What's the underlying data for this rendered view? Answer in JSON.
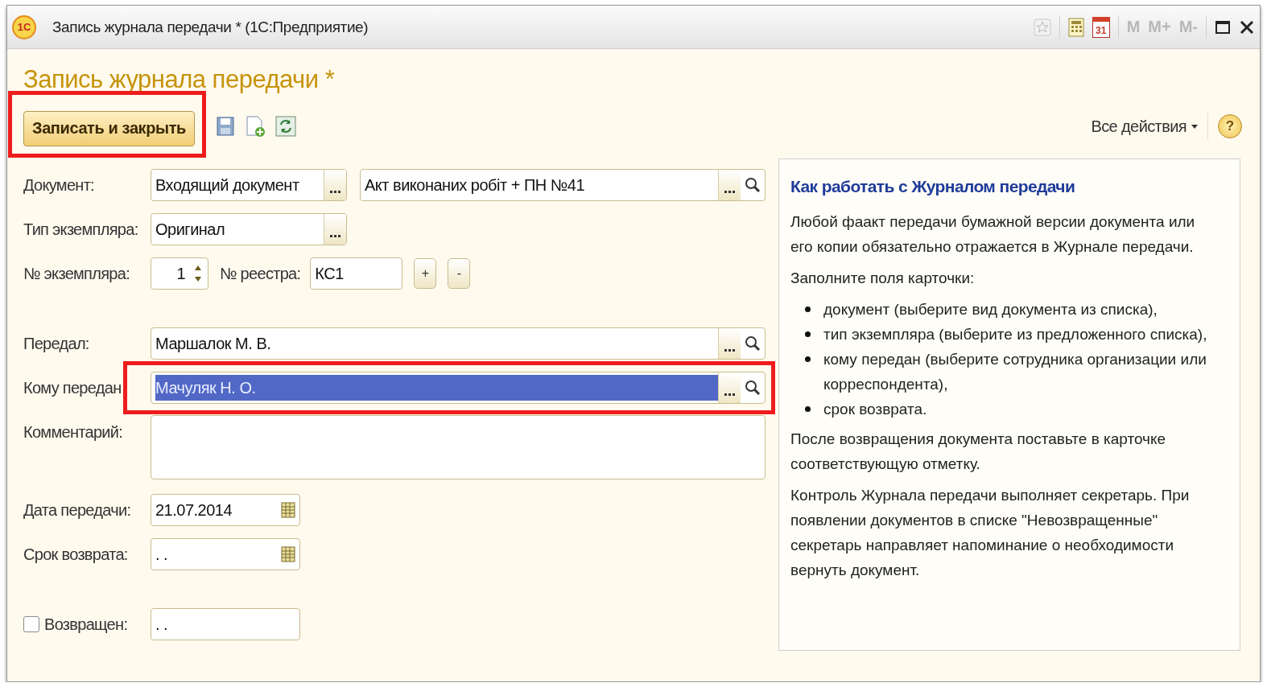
{
  "window": {
    "logo": "1С",
    "title": "Запись журнала передачи * (1С:Предприятие)",
    "calendar_day": "31",
    "memory_keys": [
      "M",
      "M+",
      "M-"
    ]
  },
  "form": {
    "title": "Запись журнала передачи *",
    "toolbar": {
      "primary": {
        "label": "Записать и закрыть",
        "highlighted": true
      },
      "all_actions": "Все действия",
      "help": "?"
    },
    "groups": [
      [
        {
          "kind": "double",
          "label": "Документ:",
          "value": "Входящий документ",
          "value2": "Акт виконаних робіт + ПН №41"
        },
        {
          "kind": "choice",
          "label": "Тип экземпляра:",
          "value": "Оригинал"
        },
        {
          "kind": "numbers",
          "label": "№ экземпляра:",
          "value": "1",
          "label2": "№ реестра:",
          "value2": "КС1",
          "plus": "+",
          "minus": "-"
        }
      ],
      [
        {
          "kind": "person",
          "label": "Передал:",
          "value": "Маршалок М. В.",
          "selected": false,
          "highlighted": false
        },
        {
          "kind": "person",
          "label": "Кому передан",
          "value": "Мачуляк Н. О.",
          "selected": true,
          "highlighted": true
        },
        {
          "kind": "memo",
          "label": "Комментарий:"
        },
        {
          "kind": "date",
          "label": "Дата передачи:",
          "value": "21.07.2014"
        },
        {
          "kind": "date",
          "label": "Срок возврата:",
          "value": ". ."
        }
      ],
      [
        {
          "kind": "checkdate",
          "label": "Возвращен:",
          "checked": false,
          "value": ". ."
        }
      ]
    ]
  },
  "help": {
    "title": "Как работать с Журналом передачи",
    "blocks": [
      {
        "kind": "para",
        "text": "Любой фаакт передачи бумажной версии документа или его копии обязательно отражается в Журнале передачи."
      },
      {
        "kind": "para",
        "text": "Заполните поля карточки:"
      },
      {
        "kind": "list",
        "items": [
          "документ (выберите вид документа из списка),",
          "тип экземпляра (выберите из предложенного списка),",
          "кому передан (выберите сотрудника организации или корреспондента),",
          "срок возврата."
        ]
      },
      {
        "kind": "para",
        "text": "После возвращения документа поставьте в карточке соответствующую отметку."
      },
      {
        "kind": "para",
        "text": "Контроль Журнала передачи выполняет секретарь. При появлении документов в списке \"Невозвращенные\" секретарь направляет напоминание о необходимости вернуть документ."
      }
    ]
  }
}
